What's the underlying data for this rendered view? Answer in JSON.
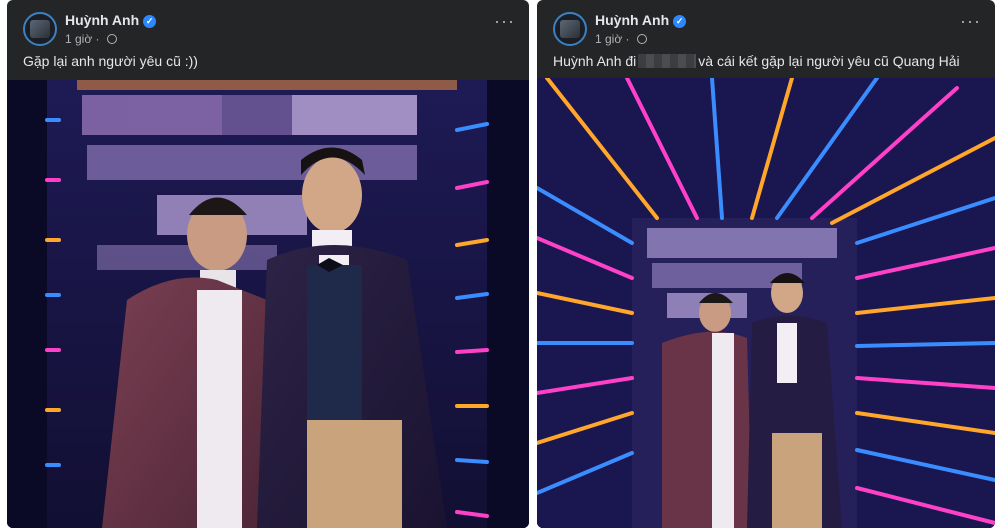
{
  "posts": [
    {
      "author": "Huỳnh Anh",
      "time": "1 giờ",
      "caption": "Gặp lại anh người yêu cũ :))"
    },
    {
      "author": "Huỳnh Anh",
      "time": "1 giờ",
      "caption_before": "Huỳnh Anh đi",
      "caption_after": "và cái kết gặp lại người yêu cũ Quang Hải"
    }
  ],
  "icons": {
    "verified": "verified-badge-icon",
    "privacy": "globe-icon",
    "menu": "more-options-icon"
  },
  "colors": {
    "card": "#242526",
    "text": "#e4e6eb",
    "muted": "#b0b3b8",
    "verified": "#2d88ff"
  }
}
